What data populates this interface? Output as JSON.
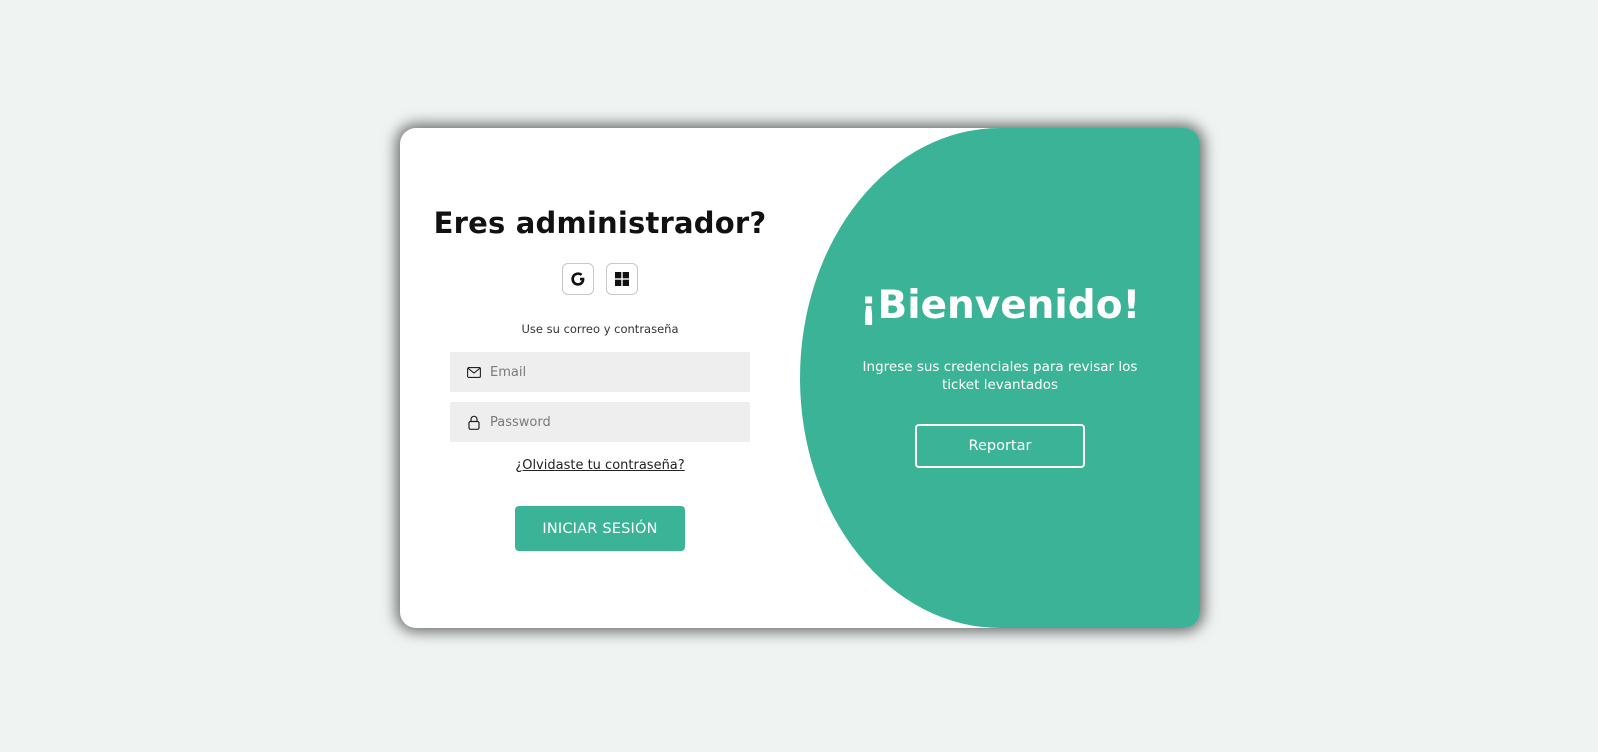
{
  "login": {
    "title": "Eres administrador?",
    "social": [
      {
        "icon": "google-icon"
      },
      {
        "icon": "windows-icon"
      }
    ],
    "subtitle": "Use su correo y contraseña",
    "email": {
      "placeholder": "Email",
      "value": "",
      "icon": "envelope-icon"
    },
    "password": {
      "placeholder": "Password",
      "value": "",
      "icon": "lock-icon"
    },
    "forgot_link": "¿Olvidaste tu contraseña?",
    "submit_label": "INICIAR SESIÓN"
  },
  "welcome": {
    "title": "¡Bienvenido!",
    "text": "Ingrese sus credenciales para revisar los ticket levantados",
    "button_label": "Reportar"
  },
  "colors": {
    "accent": "#3bb396",
    "background": "#eff3f2",
    "field_background": "#eeeeee"
  }
}
